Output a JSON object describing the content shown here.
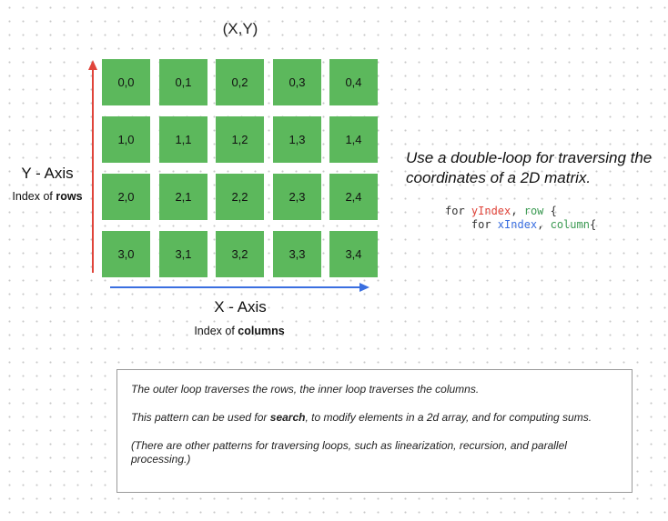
{
  "title": "(X,Y)",
  "grid": {
    "rows": [
      [
        "0,0",
        "0,1",
        "0,2",
        "0,3",
        "0,4"
      ],
      [
        "1,0",
        "1,1",
        "1,2",
        "1,3",
        "1,4"
      ],
      [
        "2,0",
        "2,1",
        "2,2",
        "2,3",
        "2,4"
      ],
      [
        "3,0",
        "3,1",
        "3,2",
        "3,3",
        "3,4"
      ]
    ],
    "cell_color": "#5cb85c"
  },
  "y_axis": {
    "label": "Y - Axis",
    "sub_prefix": "Index of ",
    "sub_bold": "rows",
    "color": "#e0443a"
  },
  "x_axis": {
    "label": "X - Axis",
    "sub_prefix": "Index of ",
    "sub_bold": "columns",
    "color": "#3a6fe0"
  },
  "note": "Use  a double-loop for traversing the coordinates of a 2D matrix.",
  "code": {
    "line1_kw": "for ",
    "line1_var": "yIndex",
    "line1_rest1": ", ",
    "line1_var2": "row",
    "line1_rest2": " {",
    "line2_kw": "    for ",
    "line2_var": "xIndex",
    "line2_rest1": ", ",
    "line2_var2": "column",
    "line2_rest2": "{"
  },
  "explanation": {
    "p1": "The outer loop traverses the rows, the inner loop traverses the columns.",
    "p2_prefix": "This pattern can be used for ",
    "p2_bold": "search",
    "p2_suffix": ", to modify elements in a 2d array, and for computing sums.",
    "p3": "(There are other patterns for traversing loops, such as linearization, recursion, and parallel processing.)"
  }
}
